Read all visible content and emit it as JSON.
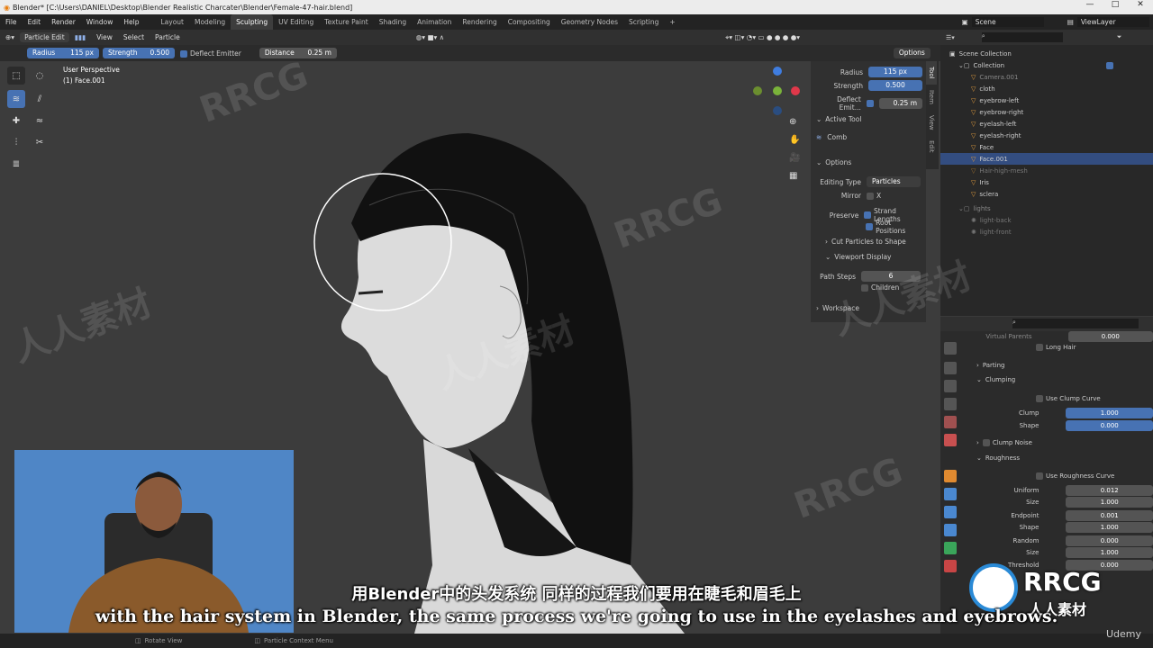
{
  "app": {
    "title": "Blender* [C:\\Users\\DANIEL\\Desktop\\Blender Realistic Charcater\\Blender\\Female-47-hair.blend]"
  },
  "menu": [
    "File",
    "Edit",
    "Render",
    "Window",
    "Help"
  ],
  "workspaces": [
    "Layout",
    "Modeling",
    "Sculpting",
    "UV Editing",
    "Texture Paint",
    "Shading",
    "Animation",
    "Rendering",
    "Compositing",
    "Geometry Nodes",
    "Scripting"
  ],
  "active_workspace": "Sculpting",
  "scene": "Scene",
  "view_layer": "ViewLayer",
  "viewport_header": {
    "mode": "Particle Edit",
    "menus": [
      "View",
      "Select",
      "Particle"
    ],
    "options": "Options"
  },
  "tool_settings": {
    "radius_label": "Radius",
    "radius_value": "115 px",
    "strength_label": "Strength",
    "strength_value": "0.500",
    "deflect_label": "Deflect Emitter",
    "distance_label": "Distance",
    "distance_value": "0.25 m"
  },
  "viewport": {
    "view_name": "User Perspective",
    "object_name": "(1) Face.001"
  },
  "npanel": {
    "radius_label": "Radius",
    "radius_value": "115 px",
    "strength_label": "Strength",
    "strength_value": "0.500",
    "deflect_label": "Deflect Emit...",
    "deflect_value": "0.25 m",
    "active_tool_header": "Active Tool",
    "tool_name": "Comb",
    "options_header": "Options",
    "editing_type_label": "Editing Type",
    "editing_type_value": "Particles",
    "mirror_label": "Mirror",
    "mirror_axis": "X",
    "preserve_label": "Preserve",
    "strand_lengths": "Strand Lengths",
    "root_positions": "Root Positions",
    "cut_particles": "Cut Particles to Shape",
    "viewport_display": "Viewport Display",
    "path_steps_label": "Path Steps",
    "path_steps_value": "6",
    "children": "Children",
    "workspace": "Workspace",
    "tabs": [
      "Tool",
      "Item",
      "View",
      "Edit"
    ]
  },
  "outliner": {
    "root": "Scene Collection",
    "collection": "Collection",
    "items": [
      "Camera.001",
      "cloth",
      "eyebrow-left",
      "eyebrow-right",
      "eyelash-left",
      "eyelash-right",
      "Face",
      "Face.001",
      "Hair-high-mesh",
      "Iris",
      "sclera"
    ],
    "lights": "lights",
    "light_items": [
      "light-back",
      "light-front"
    ]
  },
  "properties": {
    "top_label": "Virtual Parents",
    "top_value": "0.000",
    "long_hair": "Long Hair",
    "parting": "Parting",
    "clumping": "Clumping",
    "use_clump_curve": "Use Clump Curve",
    "clump_label": "Clump",
    "clump_value": "1.000",
    "shape_label": "Shape",
    "shape_value": "0.000",
    "clump_noise": "Clump Noise",
    "roughness": "Roughness",
    "use_rough_curve": "Use Roughness Curve",
    "rows": [
      [
        "Uniform",
        "0.012"
      ],
      [
        "Size",
        "1.000"
      ],
      [
        "Endpoint",
        "0.001"
      ],
      [
        "Shape",
        "1.000"
      ],
      [
        "Random",
        "0.000"
      ],
      [
        "Size",
        "1.000"
      ],
      [
        "Threshold",
        "0.000"
      ]
    ]
  },
  "status": {
    "rotate_view": "Rotate View",
    "context_menu": "Particle Context Menu"
  },
  "subtitles": {
    "chinese": "用Blender中的头发系统 同样的过程我们要用在睫毛和眉毛上",
    "english": "with the hair system in Blender, the same process we're going to use in the eyelashes and eyebrows."
  },
  "watermarks": {
    "rrcg": "RRCG",
    "cn": "人人素材",
    "udemy": "Udemy"
  },
  "colors": {
    "accent": "#4772b3",
    "selected": "#334d80"
  }
}
